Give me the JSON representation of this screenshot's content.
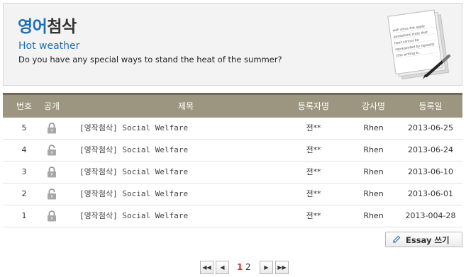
{
  "header": {
    "title_accent": "영어",
    "title_rest": "첨삭",
    "topic_title": "Hot weather",
    "topic_question": "Do you have any special ways to stand the heat of the summer?",
    "paper_lines": [
      "well since the apple",
      "quotations state that",
      "heat cannot be",
      "represented by repeatly",
      "(the writing tr..."
    ]
  },
  "table": {
    "headers": {
      "no": "번호",
      "public": "공개",
      "title": "제목",
      "author": "등록자명",
      "teacher": "강사명",
      "date": "등록일"
    },
    "rows": [
      {
        "no": "5",
        "title": "[영작첨삭] Social Welfare",
        "author": "전**",
        "teacher": "Rhen",
        "date": "2013-06-25",
        "lock": "closed"
      },
      {
        "no": "4",
        "title": "[영작첨삭] Social Welfare",
        "author": "전**",
        "teacher": "Rhen",
        "date": "2013-06-24",
        "lock": "open"
      },
      {
        "no": "3",
        "title": "[영작첨삭] Social Welfare",
        "author": "전**",
        "teacher": "Rhen",
        "date": "2013-06-10",
        "lock": "closed"
      },
      {
        "no": "2",
        "title": "[영작첨삭] Social Welfare",
        "author": "전**",
        "teacher": "Rhen",
        "date": "2013-06-01",
        "lock": "open"
      },
      {
        "no": "1",
        "title": "[영작첨삭] Social Welfare",
        "author": "전**",
        "teacher": "Rhen",
        "date": "2013-004-28",
        "lock": "closed"
      }
    ]
  },
  "actions": {
    "write_label": "Essay 쓰기"
  },
  "pagination": {
    "first": "◀◀",
    "prev": "◀",
    "next": "▶",
    "last": "▶▶",
    "pages": [
      "1",
      "2"
    ],
    "current": "1"
  },
  "colors": {
    "accent": "#1f6fb5",
    "table_header": "#9c9580",
    "current_page": "#c0392b"
  }
}
